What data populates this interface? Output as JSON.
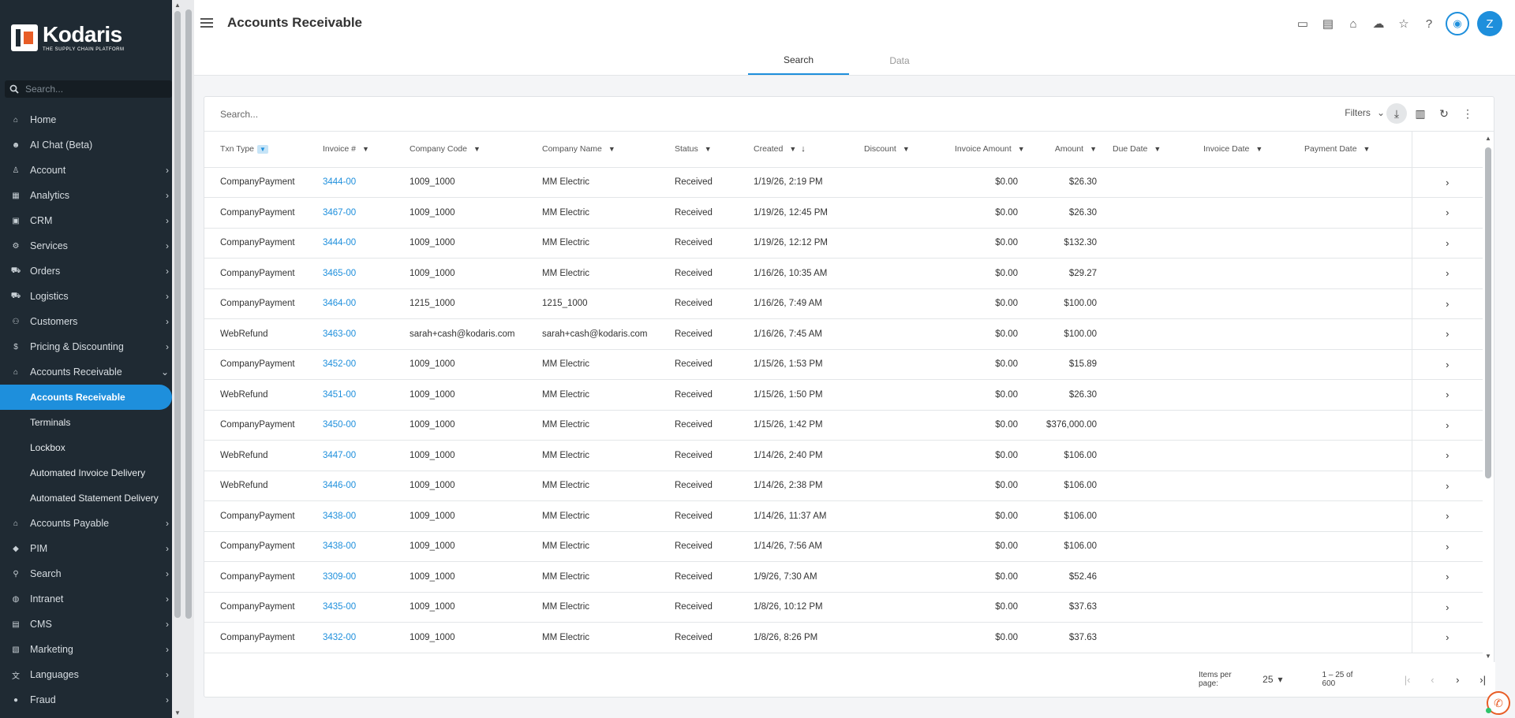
{
  "brand": {
    "name": "Kodaris",
    "tagline": "THE SUPPLY CHAIN PLATFORM"
  },
  "sidebar": {
    "search_placeholder": "Search...",
    "items": [
      {
        "label": "Home",
        "icon": "home-icon",
        "chevron": false
      },
      {
        "label": "AI Chat (Beta)",
        "icon": "robot-icon",
        "chevron": false
      },
      {
        "label": "Account",
        "icon": "person-icon",
        "chevron": true
      },
      {
        "label": "Analytics",
        "icon": "chart-icon",
        "chevron": true
      },
      {
        "label": "CRM",
        "icon": "contact-card-icon",
        "chevron": true
      },
      {
        "label": "Services",
        "icon": "services-icon",
        "chevron": true
      },
      {
        "label": "Orders",
        "icon": "car-icon",
        "chevron": true
      },
      {
        "label": "Logistics",
        "icon": "forklift-icon",
        "chevron": true
      },
      {
        "label": "Customers",
        "icon": "people-icon",
        "chevron": true
      },
      {
        "label": "Pricing & Discounting",
        "icon": "dollar-icon",
        "chevron": true
      },
      {
        "label": "Accounts Receivable",
        "icon": "bank-icon",
        "chevron": true,
        "expanded": true
      }
    ],
    "subitems": [
      {
        "label": "Accounts Receivable",
        "active": true
      },
      {
        "label": "Terminals"
      },
      {
        "label": "Lockbox"
      },
      {
        "label": "Automated Invoice Delivery"
      },
      {
        "label": "Automated Statement Delivery"
      }
    ],
    "items_after": [
      {
        "label": "Accounts Payable",
        "icon": "bank-icon"
      },
      {
        "label": "PIM",
        "icon": "tag-icon"
      },
      {
        "label": "Search",
        "icon": "search-icon"
      },
      {
        "label": "Intranet",
        "icon": "globe-icon"
      },
      {
        "label": "CMS",
        "icon": "cms-icon"
      },
      {
        "label": "Marketing",
        "icon": "marketing-icon"
      },
      {
        "label": "Languages",
        "icon": "translate-icon"
      },
      {
        "label": "Fraud",
        "icon": "alert-icon"
      }
    ]
  },
  "header": {
    "title": "Accounts Receivable",
    "avatar_initial": "Z"
  },
  "tabs": [
    {
      "label": "Search",
      "active": true
    },
    {
      "label": "Data"
    }
  ],
  "grid": {
    "search_placeholder": "Search...",
    "filters_label": "Filters",
    "columns": [
      "Txn Type",
      "Invoice #",
      "Company Code",
      "Company Name",
      "Status",
      "Created",
      "Discount",
      "Invoice Amount",
      "Amount",
      "Due Date",
      "Invoice Date",
      "Payment Date"
    ],
    "rows": [
      [
        "CompanyPayment",
        "3444-00",
        "1009_1000",
        "MM Electric",
        "Received",
        "1/19/26, 2:19 PM",
        "",
        "$0.00",
        "$26.30",
        "",
        "",
        ""
      ],
      [
        "CompanyPayment",
        "3467-00",
        "1009_1000",
        "MM Electric",
        "Received",
        "1/19/26, 12:45 PM",
        "",
        "$0.00",
        "$26.30",
        "",
        "",
        ""
      ],
      [
        "CompanyPayment",
        "3444-00",
        "1009_1000",
        "MM Electric",
        "Received",
        "1/19/26, 12:12 PM",
        "",
        "$0.00",
        "$132.30",
        "",
        "",
        ""
      ],
      [
        "CompanyPayment",
        "3465-00",
        "1009_1000",
        "MM Electric",
        "Received",
        "1/16/26, 10:35 AM",
        "",
        "$0.00",
        "$29.27",
        "",
        "",
        ""
      ],
      [
        "CompanyPayment",
        "3464-00",
        "1215_1000",
        "1215_1000",
        "Received",
        "1/16/26, 7:49 AM",
        "",
        "$0.00",
        "$100.00",
        "",
        "",
        ""
      ],
      [
        "WebRefund",
        "3463-00",
        "sarah+cash@kodaris.com",
        "sarah+cash@kodaris.com",
        "Received",
        "1/16/26, 7:45 AM",
        "",
        "$0.00",
        "$100.00",
        "",
        "",
        ""
      ],
      [
        "CompanyPayment",
        "3452-00",
        "1009_1000",
        "MM Electric",
        "Received",
        "1/15/26, 1:53 PM",
        "",
        "$0.00",
        "$15.89",
        "",
        "",
        ""
      ],
      [
        "WebRefund",
        "3451-00",
        "1009_1000",
        "MM Electric",
        "Received",
        "1/15/26, 1:50 PM",
        "",
        "$0.00",
        "$26.30",
        "",
        "",
        ""
      ],
      [
        "CompanyPayment",
        "3450-00",
        "1009_1000",
        "MM Electric",
        "Received",
        "1/15/26, 1:42 PM",
        "",
        "$0.00",
        "$376,000.00",
        "",
        "",
        ""
      ],
      [
        "WebRefund",
        "3447-00",
        "1009_1000",
        "MM Electric",
        "Received",
        "1/14/26, 2:40 PM",
        "",
        "$0.00",
        "$106.00",
        "",
        "",
        ""
      ],
      [
        "WebRefund",
        "3446-00",
        "1009_1000",
        "MM Electric",
        "Received",
        "1/14/26, 2:38 PM",
        "",
        "$0.00",
        "$106.00",
        "",
        "",
        ""
      ],
      [
        "CompanyPayment",
        "3438-00",
        "1009_1000",
        "MM Electric",
        "Received",
        "1/14/26, 11:37 AM",
        "",
        "$0.00",
        "$106.00",
        "",
        "",
        ""
      ],
      [
        "CompanyPayment",
        "3438-00",
        "1009_1000",
        "MM Electric",
        "Received",
        "1/14/26, 7:56 AM",
        "",
        "$0.00",
        "$106.00",
        "",
        "",
        ""
      ],
      [
        "CompanyPayment",
        "3309-00",
        "1009_1000",
        "MM Electric",
        "Received",
        "1/9/26, 7:30 AM",
        "",
        "$0.00",
        "$52.46",
        "",
        "",
        ""
      ],
      [
        "CompanyPayment",
        "3435-00",
        "1009_1000",
        "MM Electric",
        "Received",
        "1/8/26, 10:12 PM",
        "",
        "$0.00",
        "$37.63",
        "",
        "",
        ""
      ],
      [
        "CompanyPayment",
        "3432-00",
        "1009_1000",
        "MM Electric",
        "Received",
        "1/8/26, 8:26 PM",
        "",
        "$0.00",
        "$37.63",
        "",
        "",
        ""
      ]
    ]
  },
  "pager": {
    "items_per_page_label": "Items per page:",
    "page_size": "25",
    "range": "1 – 25 of 600"
  },
  "colors": {
    "accent": "#1e8fdc",
    "sidebar_bg": "#1f2a33",
    "brand_orange": "#e85d26"
  }
}
